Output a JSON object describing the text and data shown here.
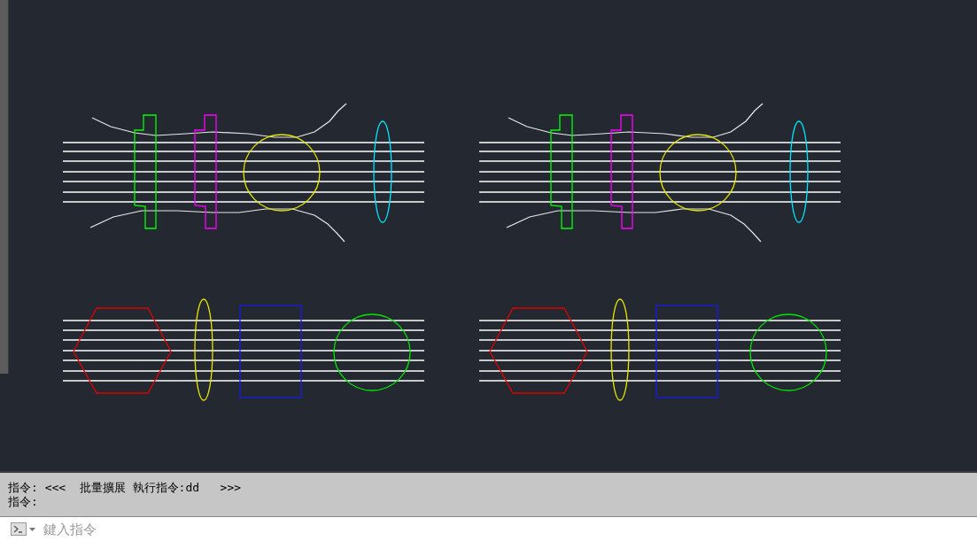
{
  "command_history": [
    "指令: <<<  批量擴展 執行指令:dd   >>>",
    "指令:"
  ],
  "command_input": {
    "placeholder": "鍵入指令"
  }
}
